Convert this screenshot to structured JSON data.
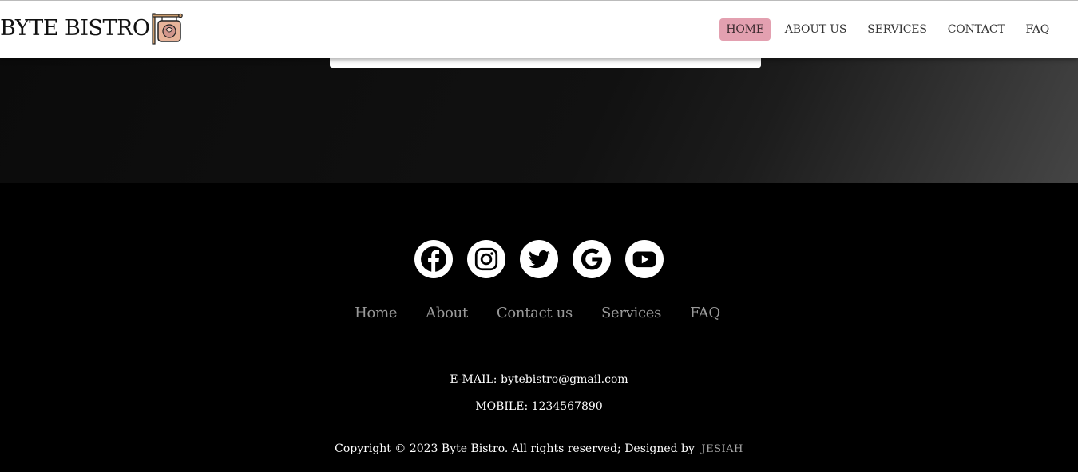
{
  "header": {
    "brand": "BYTE BISTRO",
    "logo_icon": "hanging-sign-icon",
    "nav": [
      {
        "label": "HOME",
        "active": true
      },
      {
        "label": "ABOUT US",
        "active": false
      },
      {
        "label": "SERVICES",
        "active": false
      },
      {
        "label": "CONTACT",
        "active": false
      },
      {
        "label": "FAQ",
        "active": false
      }
    ],
    "active_color": "#e3a0b0"
  },
  "footer": {
    "socials": [
      {
        "name": "facebook-icon"
      },
      {
        "name": "instagram-icon"
      },
      {
        "name": "twitter-icon"
      },
      {
        "name": "google-icon"
      },
      {
        "name": "youtube-icon"
      }
    ],
    "links": [
      "Home",
      "About",
      "Contact us",
      "Services",
      "FAQ"
    ],
    "email": "E-MAIL: bytebistro@gmail.com",
    "mobile": "MOBILE: 1234567890",
    "copyright": "Copyright © 2023 Byte Bistro. All rights reserved; Designed by",
    "designer": "JESIAH"
  }
}
